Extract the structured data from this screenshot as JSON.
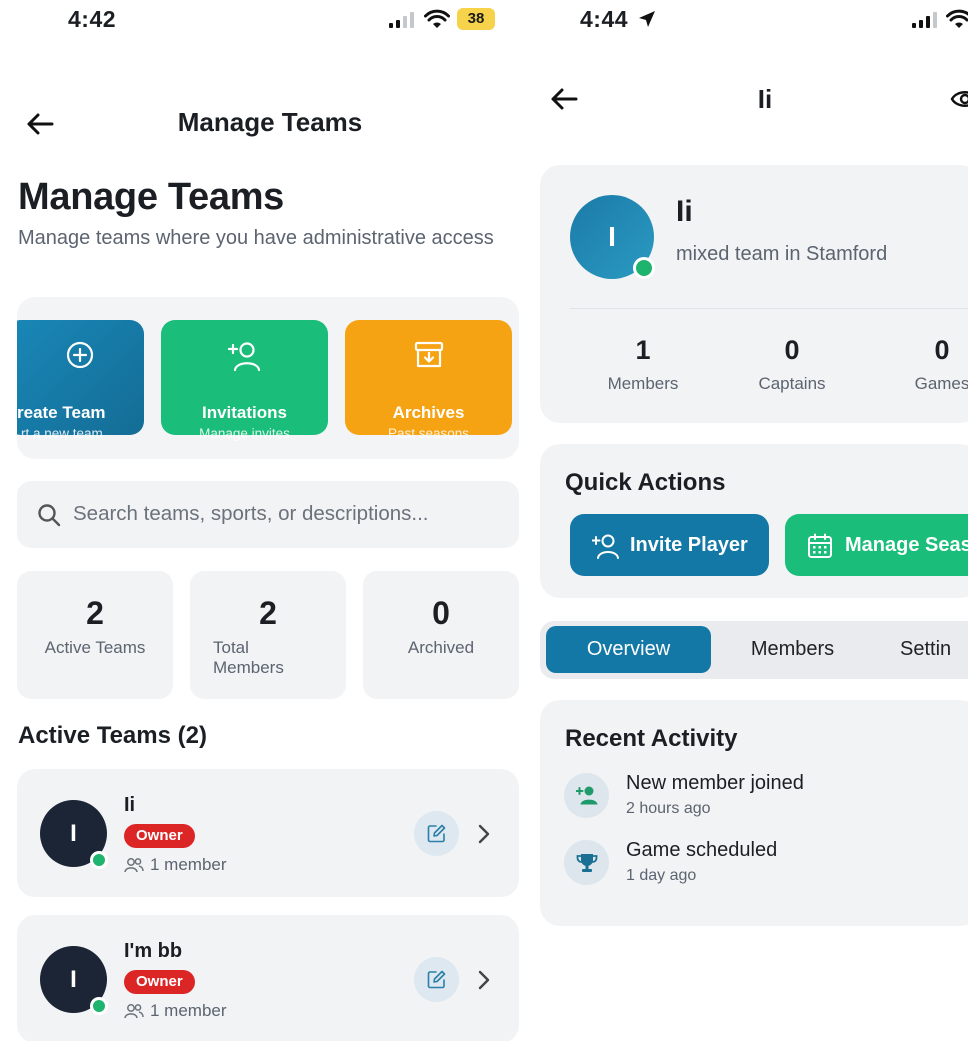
{
  "left": {
    "status": {
      "time": "4:42",
      "battery": "38"
    },
    "header": {
      "title": "Manage Teams"
    },
    "page_title": "Manage Teams",
    "subtitle": "Manage teams where you have administrative access",
    "actions": [
      {
        "label": "reate Team",
        "sub": "rt a new team",
        "icon": "plus-circle-icon",
        "color": "#1987b8"
      },
      {
        "label": "Invitations",
        "sub": "Manage invites",
        "icon": "add-user-icon",
        "color": "#1bbd7a"
      },
      {
        "label": "Archives",
        "sub": "Past seasons",
        "icon": "archive-icon",
        "color": "#f6a313"
      }
    ],
    "search": {
      "placeholder": "Search teams, sports, or descriptions..."
    },
    "stats": [
      {
        "value": "2",
        "label": "Active Teams"
      },
      {
        "value": "2",
        "label": "Total Members"
      },
      {
        "value": "0",
        "label": "Archived"
      }
    ],
    "section_title": "Active Teams (2)",
    "teams": [
      {
        "initial": "I",
        "name": "Ii",
        "role": "Owner",
        "members": "1 member"
      },
      {
        "initial": "I",
        "name": "I'm bb",
        "role": "Owner",
        "members": "1 member"
      }
    ]
  },
  "right": {
    "status": {
      "time": "4:44"
    },
    "header": {
      "title": "Ii"
    },
    "profile": {
      "initial": "I",
      "name": "Ii",
      "description": "mixed team in Stamford",
      "stats": [
        {
          "value": "1",
          "label": "Members"
        },
        {
          "value": "0",
          "label": "Captains"
        },
        {
          "value": "0",
          "label": "Games"
        }
      ]
    },
    "quick_actions": {
      "title": "Quick Actions",
      "invite": "Invite Player",
      "manage": "Manage Seas"
    },
    "tabs": [
      "Overview",
      "Members",
      "Settin"
    ],
    "activity": {
      "title": "Recent Activity",
      "items": [
        {
          "text": "New member joined",
          "time": "2 hours ago",
          "icon": "add-user-icon"
        },
        {
          "text": "Game scheduled",
          "time": "1 day ago",
          "icon": "trophy-icon"
        }
      ]
    }
  },
  "colors": {
    "primary_blue": "#1478a6",
    "green": "#1bbd7a",
    "orange": "#f6a313",
    "owner_red": "#dc2626",
    "online_dot": "#1fb46e"
  }
}
